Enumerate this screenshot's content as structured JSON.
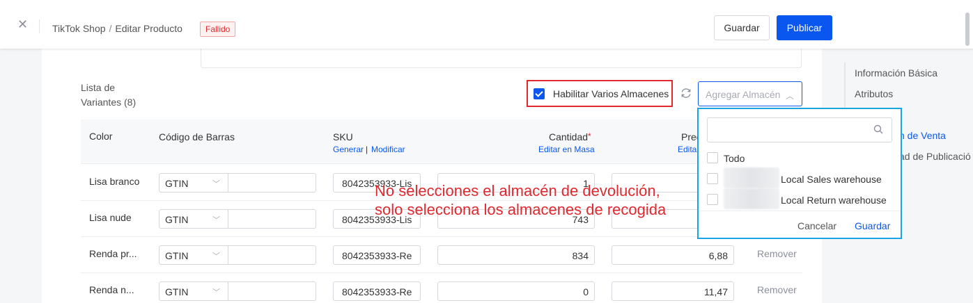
{
  "header": {
    "close_icon": "close-icon",
    "breadcrumb_parent": "TikTok Shop",
    "breadcrumb_sep": "/",
    "breadcrumb_current": "Editar Producto",
    "status_badge": "Fallido",
    "save_label": "Guardar",
    "publish_label": "Publicar",
    "publish_color": "#0a57f0"
  },
  "variants": {
    "title": "Lista de Variantes (8)",
    "multi_warehouse_label": "Habilitar Varios Almacenes",
    "multi_warehouse_checked": true,
    "add_warehouse_placeholder": "Agregar Almacén",
    "columns": {
      "color": "Color",
      "barcode": "Código de Barras",
      "sku": "SKU",
      "sku_generate": "Generar",
      "sku_sep": "|",
      "sku_modify": "Modificar",
      "quantity": "Cantidad",
      "quantity_required": "*",
      "quantity_bulk": "Editar en Masa",
      "price": "Prec",
      "price_bulk": "Edita"
    },
    "rows": [
      {
        "color": "Lisa branco",
        "barcode_type": "GTIN",
        "sku": "8042353933-Lis",
        "quantity": "1",
        "price": "",
        "remove": ""
      },
      {
        "color": "Lisa nude",
        "barcode_type": "GTIN",
        "sku": "8042353933-Lis",
        "quantity": "743",
        "price": "",
        "remove": ""
      },
      {
        "color": "Renda pr...",
        "barcode_type": "GTIN",
        "sku": "8042353933-Re",
        "quantity": "834",
        "price": "6,88",
        "remove": "Remover"
      },
      {
        "color": "Renda n...",
        "barcode_type": "GTIN",
        "sku": "8042353933-Re",
        "quantity": "0",
        "price": "11,47",
        "remove": "Remover"
      }
    ]
  },
  "warehouse_dropdown": {
    "search_placeholder": "",
    "all_label": "Todo",
    "options": [
      {
        "label": "Local Sales warehouse",
        "checked": false
      },
      {
        "label": "Local Return warehouse",
        "checked": false
      }
    ],
    "cancel_label": "Cancelar",
    "save_label": "Guardar"
  },
  "right_nav": {
    "items": [
      {
        "label": "Información Básica",
        "active": false
      },
      {
        "label": "Atributos",
        "active": false
      },
      {
        "label": "n de Venta",
        "active": true
      },
      {
        "label": "ad de Publicació",
        "active": false
      }
    ]
  },
  "annotation": {
    "line1": "No selecciones el almacén de devolución,",
    "line2": "solo selecciona los almacenes de recogida",
    "color": "#e0282e"
  }
}
